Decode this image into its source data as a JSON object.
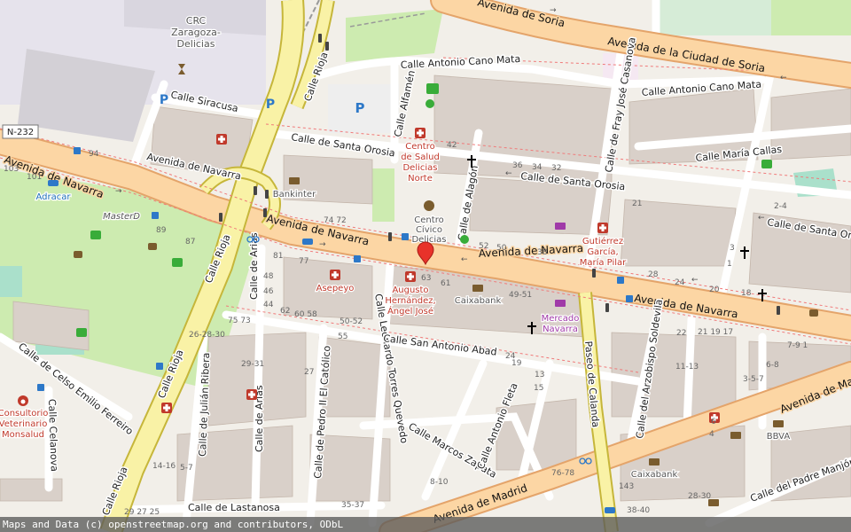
{
  "attribution": "Maps and Data (c) openstreetmap.org and contributors, ODbL",
  "roads": {
    "navarra_main": "Avenida de Navarra",
    "navarra_west": "Avenida de Navarra",
    "navarra_east": "Avenida de Navarra",
    "navarra_sw": "Avenida de Navarra",
    "soria_top": "Avenida de Soria",
    "soria": "Avenida de la Ciudad de Soria",
    "madrid_sw": "Avenida de Madrid",
    "madrid_ne": "Avenida de Madrid",
    "rioja_top": "Calle Rioja",
    "rioja_mid": "Calle Rioja",
    "rioja_low": "Calle Rioja",
    "rioja_bottom": "Calle Rioja",
    "siracusa": "Calle Siracusa",
    "cano_mata_w": "Calle Antonio Cano Mata",
    "cano_mata_e": "Calle Antonio Cano Mata",
    "alfamen": "Calle Alfamén",
    "santa_orosia_w": "Calle de Santa Orosia",
    "santa_orosia_m": "Calle de Santa Orosia",
    "santa_orosia_e": "Calle de Santa Orosia",
    "maria_callas": "Calle María Callas",
    "fray_jose": "Calle de Fray José Casanova",
    "alagon": "Calle de Alagón",
    "arias_top": "Calle de Arias",
    "arias_bottom": "Calle de Arias",
    "torres_quevedo": "Calle Leonardo Torres Quevedo",
    "san_antonio_abad": "Calle San Antonio Abad",
    "julian_ribera": "Calle de Julián Ribera",
    "pedro_ii": "Calle de Pedro II El Católico",
    "marcos_zapata": "Calle Marcos Zapata",
    "antonio_fleta": "Calle Antonio Fleta",
    "paseo_calanda": "Paseo de Calanda",
    "arzobispo": "Calle del Arzobispo Soldevila",
    "padre_manjon": "Calle del Padre Manjón",
    "lastanosa": "Calle de Lastanosa",
    "celso": "Calle de Celso Emilio Ferreiro",
    "celanova": "Calle Celanova",
    "route_ref": "N-232"
  },
  "pois": {
    "crc": [
      "CRC",
      "Zaragoza-",
      "Delicias"
    ],
    "centro_salud": [
      "Centro",
      "de Salud",
      "Delicias",
      "Norte"
    ],
    "centro_civico": [
      "Centro",
      "Cívico",
      "Delicias"
    ],
    "bankinter": "Bankinter",
    "adracar": "Adracar",
    "masterd": "MasterD",
    "asepeyo": "Asepeyo",
    "augusto": [
      "Augusto",
      "Hernández,",
      "Ángel José"
    ],
    "caixabank_1": "Caixabank",
    "caixabank_2": "Caixabank",
    "mercado": [
      "Mercado",
      "Navarra"
    ],
    "gutierrez": [
      "Gutiérrez",
      "García,",
      "María Pilar"
    ],
    "consultorio": [
      "Consultorio",
      "Veterinario",
      "Monsalud"
    ],
    "bbva": "BBVA"
  },
  "house_numbers": {
    "n103": "103",
    "n101": "101",
    "n94": "94",
    "n89": "89",
    "n87": "87",
    "n81": "81",
    "n77": "77",
    "n74_72": "74 72",
    "n42": "42",
    "n36": "36",
    "n34": "34",
    "n32": "32",
    "n52": "52",
    "n50": "50",
    "n38": "38",
    "n63": "63",
    "n61": "61",
    "n49_51": "49-51",
    "n28": "28",
    "n24": "24",
    "n20": "20",
    "n18": "18",
    "n21": "21",
    "n2_4": "2-4",
    "n3": "3",
    "n1": "1",
    "n48": "48",
    "n46": "46",
    "n44": "44",
    "n62": "62",
    "n60_58": "60 58",
    "n50_52": "50-52",
    "n75_73": "75 73",
    "n55": "55",
    "n26_28_30": "26-28-30",
    "n29_31": "29-31",
    "n27": "27",
    "n19": "19",
    "n13": "13",
    "n15": "15",
    "n11_13": "11-13",
    "n3_5_7": "3-5-7",
    "n6_8": "6-8",
    "n7_9_1": "7-9 1",
    "n14_16": "14-16",
    "n5_7": "5-7",
    "n29_27_25": "29 27 25",
    "n35_37": "35-37",
    "n76_78": "76-78",
    "n143": "143",
    "n28_30": "28-30",
    "n38_40": "38-40",
    "n8_10": "8-10",
    "n24b": "24",
    "n21_19_17": "21 19 17",
    "n22": "22",
    "n6": "6",
    "n4": "4"
  },
  "marker": {
    "label": "Selected location",
    "color": "#e8322a"
  },
  "colors": {
    "background": "#f2efe9",
    "primary_road": "#fcd6a4",
    "primary_casing": "#e4a46a",
    "trunk": "#f9f2a6",
    "building": "#d9d0c9",
    "park": "#cdebb0",
    "pitch": "#aae0cb",
    "railway_area": "#e6d8e2"
  }
}
